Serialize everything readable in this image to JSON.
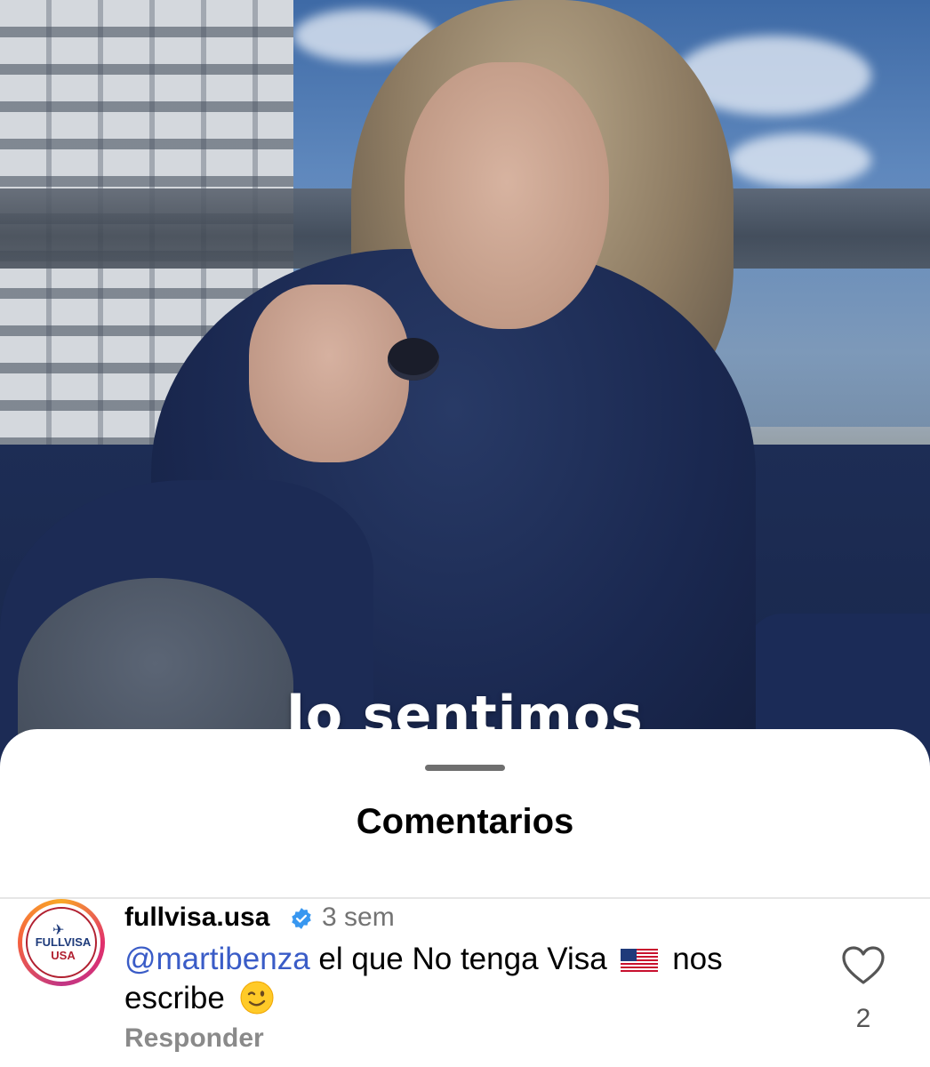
{
  "video": {
    "caption": "lo sentimos"
  },
  "sheet": {
    "title": "Comentarios"
  },
  "comment": {
    "username": "fullvisa.usa",
    "verified": true,
    "time": "3 sem",
    "mention": "@martibenza",
    "text_part1": "el que No tenga Visa",
    "text_part2": "nos",
    "text_part3": "escribe",
    "flag_icon": "us-flag-emoji",
    "emoji_icon": "winking-face-emoji",
    "reply_label": "Responder",
    "like_count": "2",
    "avatar_logo_top": "FULLVISA",
    "avatar_logo_bottom": "USA"
  },
  "colors": {
    "mention": "#3a5cc7",
    "verified": "#3897f0",
    "secondary_text": "#737373"
  }
}
